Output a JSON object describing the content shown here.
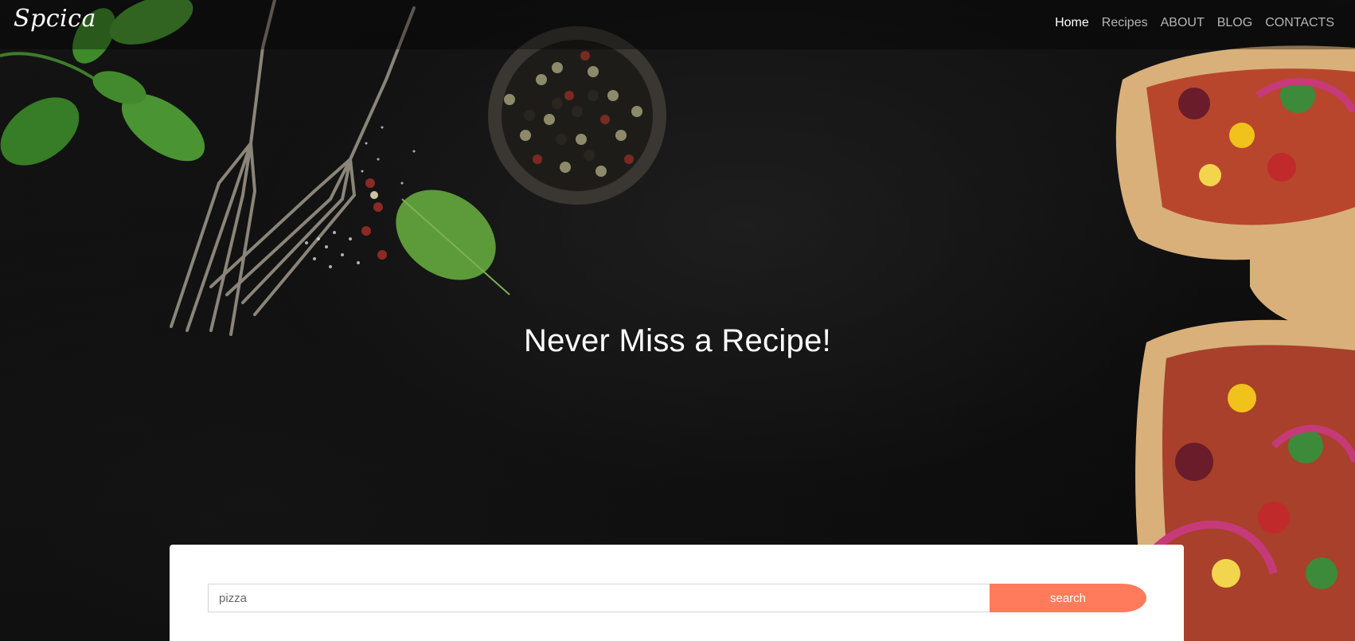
{
  "brand": {
    "logo_text": "Spcica"
  },
  "nav": {
    "items": [
      {
        "label": "Home",
        "active": true
      },
      {
        "label": "Recipes",
        "active": false
      },
      {
        "label": "ABOUT",
        "active": false
      },
      {
        "label": "BLOG",
        "active": false
      },
      {
        "label": "CONTACTS",
        "active": false
      }
    ]
  },
  "hero": {
    "headline": "Never Miss a Recipe!"
  },
  "search": {
    "value": "pizza",
    "button_label": "search"
  },
  "colors": {
    "accent": "#ff7b5c",
    "background": "#0b0b0b",
    "text_light": "#ffffff",
    "nav_inactive": "#b5b5b5"
  }
}
